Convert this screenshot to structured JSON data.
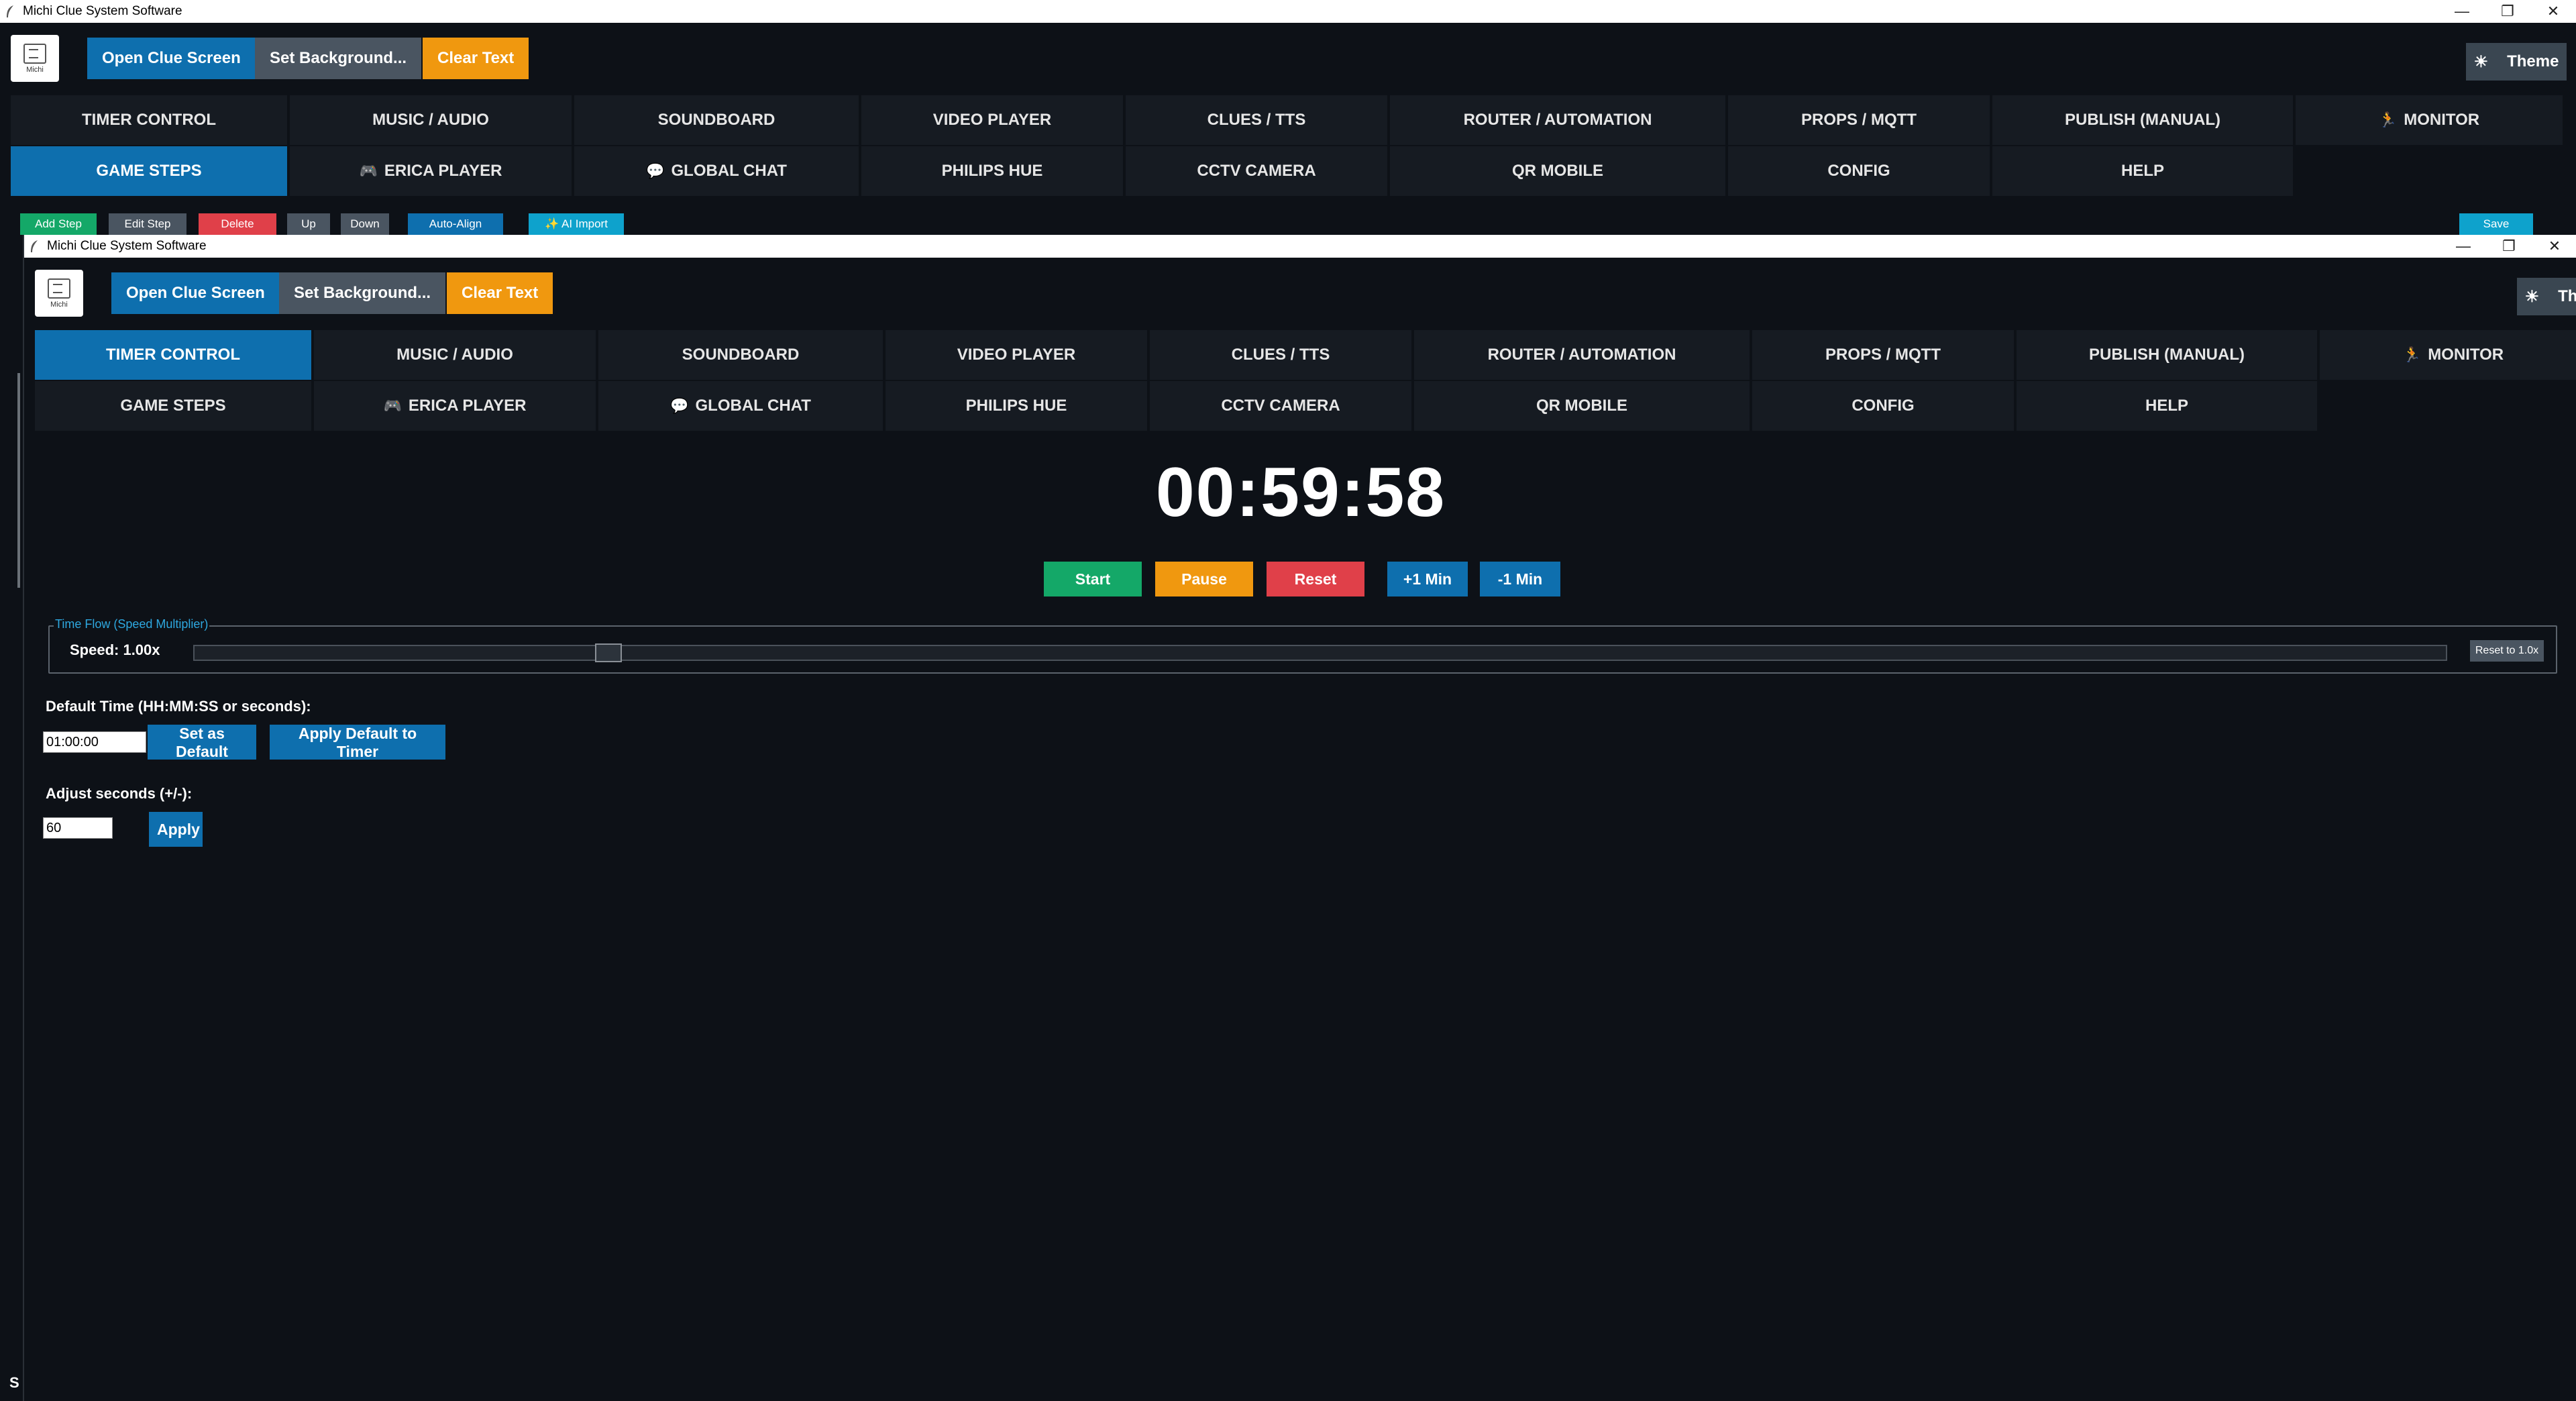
{
  "window_title": "Michi Clue System Software",
  "window_controls": {
    "minimize": "—",
    "maximize": "❐",
    "close": "✕"
  },
  "toolbar": {
    "logo_text": "Michi",
    "open_clue_screen": "Open Clue Screen",
    "set_background": "Set Background...",
    "clear_text": "Clear Text",
    "theme": "Theme",
    "theme_icon": "☀"
  },
  "tabs": {
    "row1": [
      "TIMER CONTROL",
      "MUSIC / AUDIO",
      "SOUNDBOARD",
      "VIDEO PLAYER",
      "CLUES / TTS",
      "ROUTER / AUTOMATION",
      "PROPS / MQTT",
      "PUBLISH (MANUAL)",
      "MONITOR"
    ],
    "row2": [
      "GAME STEPS",
      "ERICA PLAYER",
      "GLOBAL CHAT",
      "PHILIPS HUE",
      "CCTV CAMERA",
      "QR MOBILE",
      "CONFIG",
      "HELP"
    ],
    "icons": {
      "monitor": "🏃",
      "erica_player": "🎮",
      "global_chat": "💬"
    }
  },
  "back_window": {
    "active_tab": "GAME STEPS",
    "step_tools": {
      "add_step": "Add Step",
      "edit_step": "Edit Step",
      "delete": "Delete",
      "up": "Up",
      "down": "Down",
      "auto_align": "Auto-Align",
      "ai_import": "✨ AI Import",
      "save": "Save"
    }
  },
  "front_window": {
    "active_tab": "TIMER CONTROL",
    "timer": "00:59:58",
    "controls": {
      "start": "Start",
      "pause": "Pause",
      "reset": "Reset",
      "plus_min": "+1 Min",
      "minus_min": "-1 Min"
    },
    "speed": {
      "legend": "Time Flow (Speed Multiplier)",
      "label": "Speed: 1.00x",
      "value_fraction": 0.18,
      "reset": "Reset to 1.0x"
    },
    "default_time": {
      "label": "Default Time (HH:MM:SS or seconds):",
      "value": "01:00:00",
      "set_default": "Set as Default",
      "apply_default": "Apply Default to Timer"
    },
    "adjust": {
      "label": "Adjust seconds (+/-):",
      "value": "60",
      "apply": "Apply"
    }
  },
  "status_corner": "S"
}
